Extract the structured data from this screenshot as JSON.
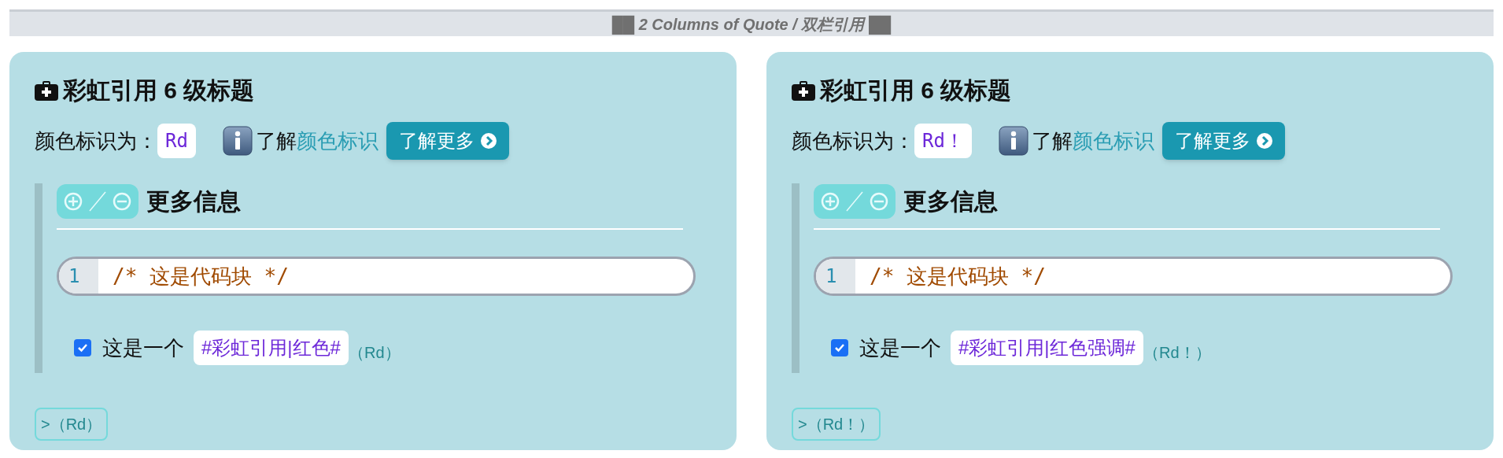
{
  "banner": {
    "text": "██ 2 Columns of Quote / 双栏引用 ██"
  },
  "cards": [
    {
      "heading": "彩虹引用 6 级标题",
      "color_label": "颜色标识为：",
      "color_code": "Rd",
      "learn_prefix": "了解",
      "learn_link": "颜色标识",
      "more_button": "了解更多",
      "details": {
        "title": "更多信息",
        "code_lines": [
          {
            "number": "1",
            "text": "/* 这是代码块 */"
          }
        ],
        "task": {
          "checked": true,
          "text": "这是一个",
          "tag": "#彩虹引用|红色#",
          "suffix": "（Rd）"
        }
      },
      "footer_tag": ">（Rd）"
    },
    {
      "heading": "彩虹引用 6 级标题",
      "color_label": "颜色标识为：",
      "color_code": "Rd！",
      "learn_prefix": "了解",
      "learn_link": "颜色标识",
      "more_button": "了解更多",
      "details": {
        "title": "更多信息",
        "code_lines": [
          {
            "number": "1",
            "text": "/* 这是代码块 */"
          }
        ],
        "task": {
          "checked": true,
          "text": "这是一个",
          "tag": "#彩虹引用|红色强调#",
          "suffix": "（Rd！）"
        }
      },
      "footer_tag": ">（Rd！）"
    }
  ]
}
